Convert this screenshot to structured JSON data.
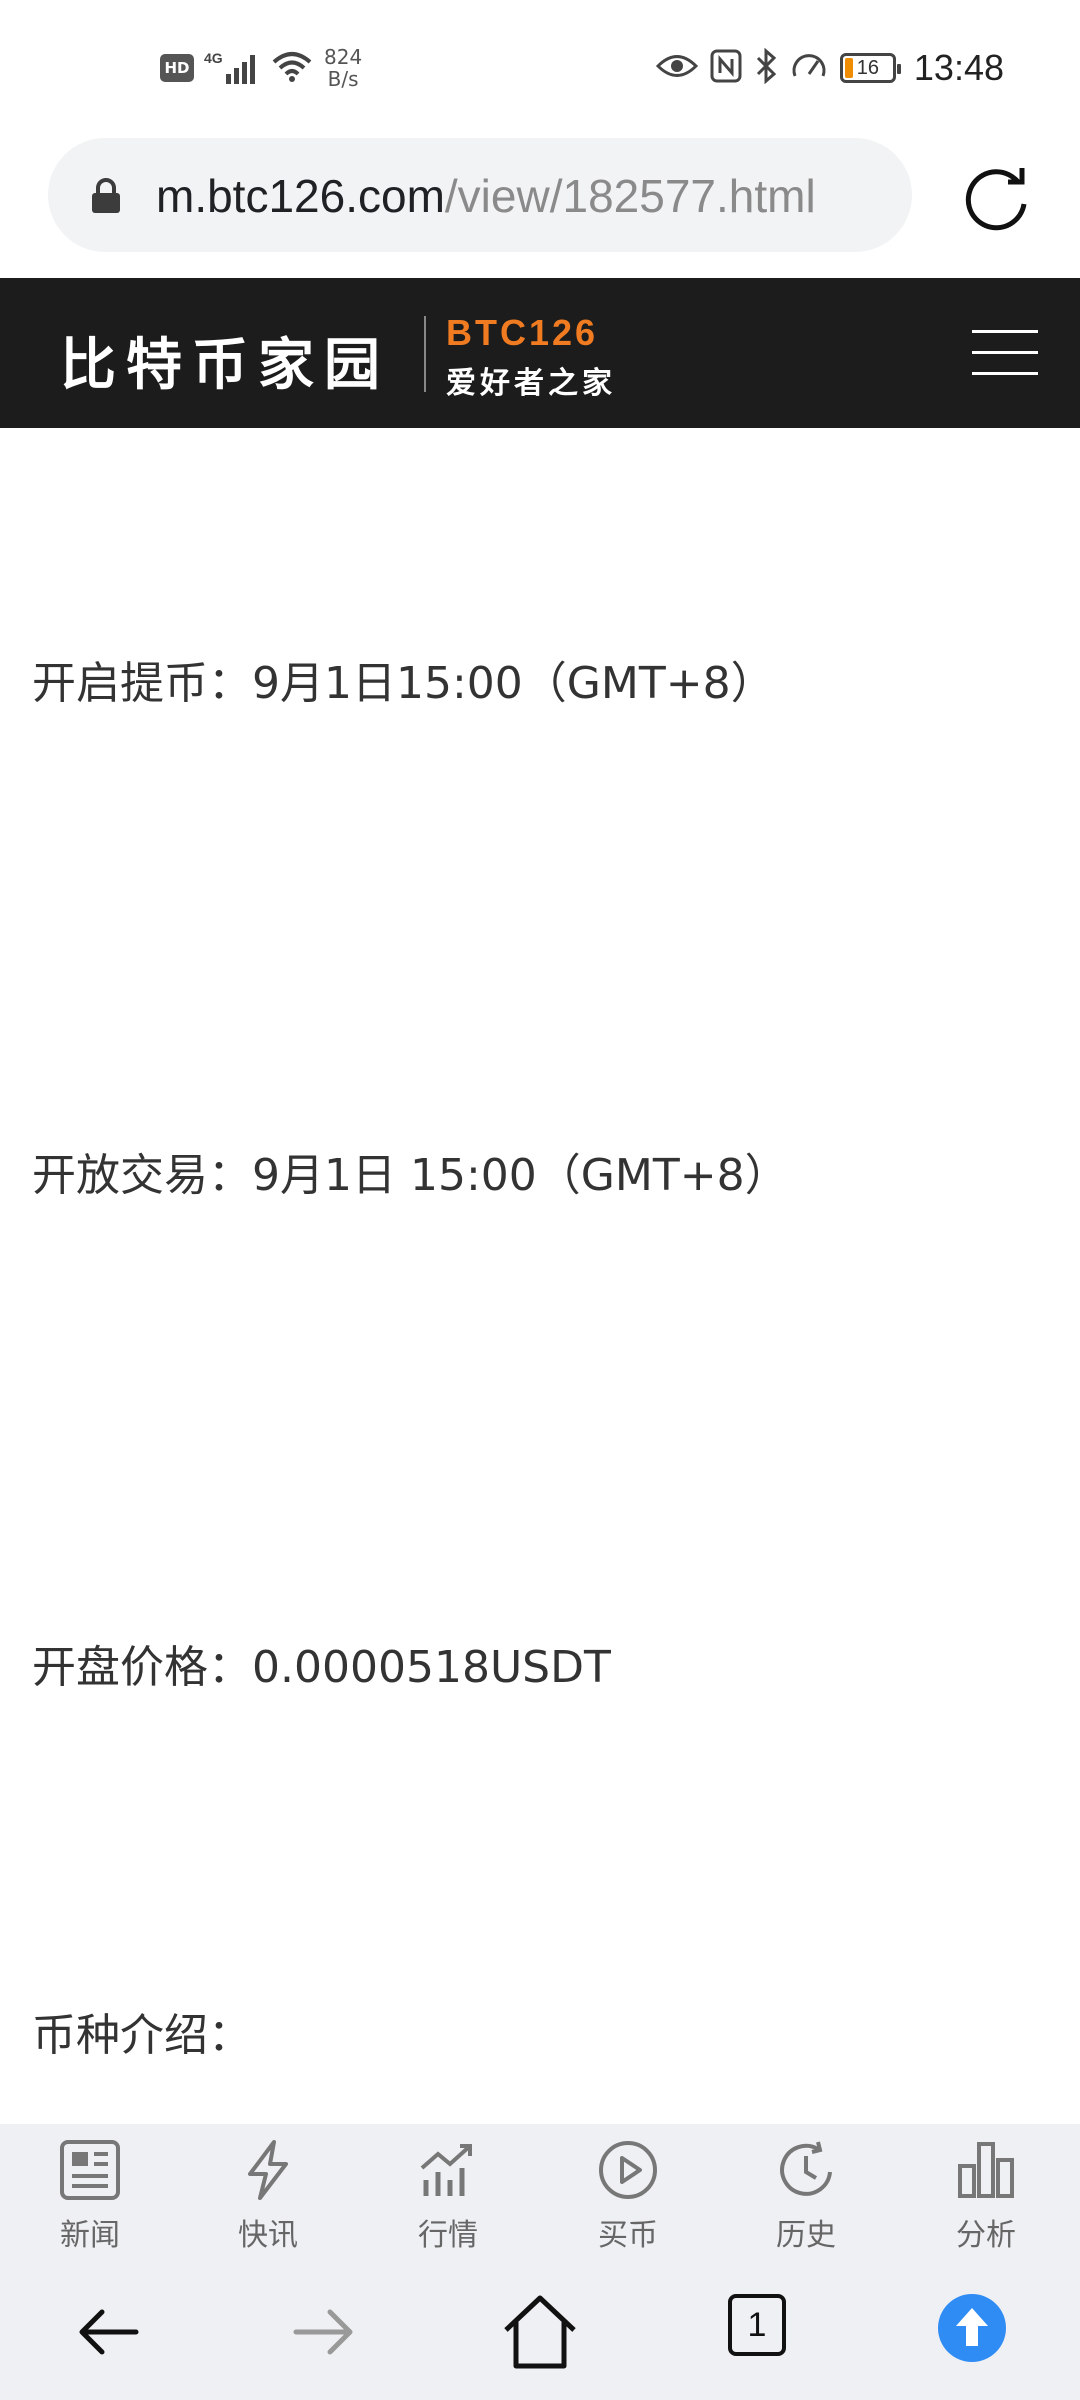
{
  "status_bar": {
    "hd": "HD",
    "network": "4G",
    "net_speed_value": "824",
    "net_speed_unit": "B/s",
    "battery_level": "16",
    "time": "13:48"
  },
  "url_bar": {
    "host": "m.btc126.com",
    "path": "/view/182577.html"
  },
  "site_header": {
    "logo_cn": "比特币家园",
    "logo_en": "BTC126",
    "logo_sub": "爱好者之家"
  },
  "article": {
    "line1": "开启提币：9月1日15:00（GMT+8）",
    "line2": "开放交易：9月1日 15:00（GMT+8）",
    "line3": "开盘价格：0.0000518USDT",
    "line4": "币种介绍："
  },
  "bottom_tabs": [
    {
      "label": "新闻",
      "icon": "newspaper-icon"
    },
    {
      "label": "快讯",
      "icon": "lightning-icon"
    },
    {
      "label": "行情",
      "icon": "market-chart-icon"
    },
    {
      "label": "买币",
      "icon": "play-circle-icon"
    },
    {
      "label": "历史",
      "icon": "history-clock-icon"
    },
    {
      "label": "分析",
      "icon": "bar-chart-icon"
    }
  ],
  "browser_nav": {
    "tab_count": "1"
  },
  "colors": {
    "header_bg": "#1c1c1c",
    "brand_orange": "#f07b20",
    "accent_blue": "#2f8cf4",
    "nav_bg": "#eef0f3"
  }
}
